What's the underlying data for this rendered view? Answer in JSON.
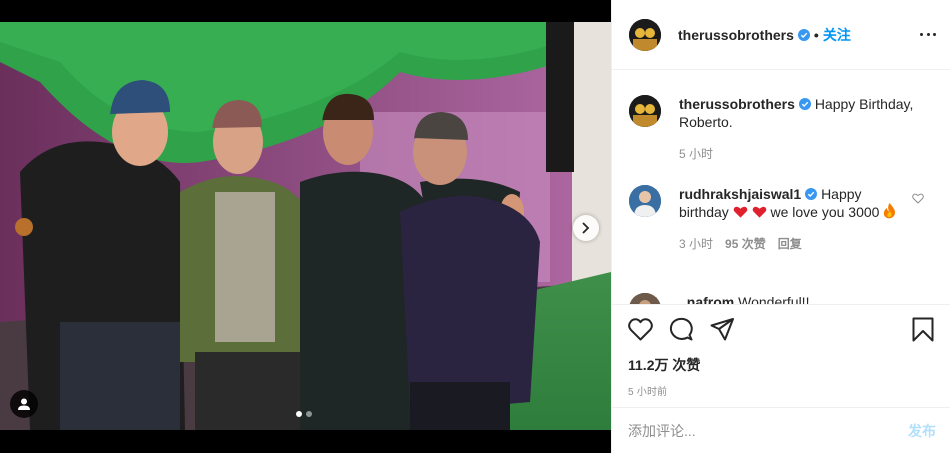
{
  "post": {
    "author": "therussobrothers",
    "follow_separator": "•",
    "follow_label": "关注",
    "more_icon": "more-options-icon",
    "photo": {
      "current_slide": 1,
      "total_slides": 2,
      "people": 4
    }
  },
  "comments": [
    {
      "username": "therussobrothers",
      "verified": true,
      "text": "Happy Birthday, Roberto.",
      "time": "5 小时"
    },
    {
      "username": "rudhrakshjaiswal1",
      "verified": true,
      "text_before": "Happy birthday",
      "text_after": "we love you 3000",
      "emojis": [
        "red-heart",
        "red-heart",
        "fire"
      ],
      "time": "3 小时",
      "likes": "95 次赞",
      "reply_label": "回复"
    },
    {
      "username": "_nafrom",
      "text": "Wonderful!!"
    }
  ],
  "actions": {
    "likes": "11.2万 次赞",
    "posted_time": "5 小时前"
  },
  "composer": {
    "placeholder": "添加评论...",
    "post_label": "发布"
  },
  "colors": {
    "accent": "#0095f6",
    "post_disabled": "#b2dffc",
    "heart": "#ed4956",
    "muted": "#8e8e8e"
  }
}
